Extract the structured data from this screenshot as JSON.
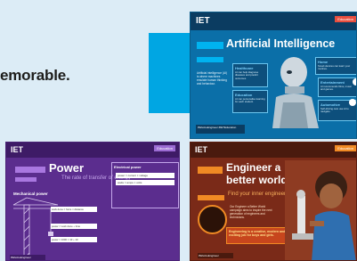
{
  "headline": "emorable.",
  "cards": {
    "ai": {
      "brand": "IET",
      "badge": "Education",
      "title": "Artificial Intelligence",
      "intro": "Artificial intelligence (AI) is where machines emulate human thinking and behaviour.",
      "boxes": [
        {
          "title": "Healthcare",
          "text": "AI can help diagnose diseases and predict outcomes."
        },
        {
          "title": "Education",
          "text": "AI can personalise learning for each student."
        },
        {
          "title": "Home",
          "text": "Smart devices can learn your routines."
        },
        {
          "title": "Entertainment",
          "text": "AI recommends films, music and games."
        },
        {
          "title": "Automotive",
          "text": "Self-driving cars use AI to navigate."
        }
      ],
      "footer": "#WeAreEngineer #IETEducation"
    },
    "power": {
      "brand": "IET",
      "badge": "Education",
      "title": "Power",
      "subtitle": "The rate of transfer of energy",
      "electrical_label": "Electrical power",
      "formulas": [
        "power = current × voltage",
        "watts = amps × volts"
      ],
      "mechanical_label": "Mechanical power",
      "work_formulas": [
        "work done = force × distance",
        "power = work done ÷ time",
        "power = 1000 × 10 ÷ 10"
      ],
      "footer": "#WeAreEngineer"
    },
    "engineer": {
      "brand": "IET",
      "badge": "Education",
      "title": "Engineer a better world",
      "inner": "Find your inner engineer",
      "intro": "Our Engineer a Better World campaign aims to inspire the next generation of engineers and technicians.",
      "orange_text": "Engineering is a creative, modern and exciting job for boys and girls.",
      "footer": "#WeAreEngineer"
    }
  }
}
